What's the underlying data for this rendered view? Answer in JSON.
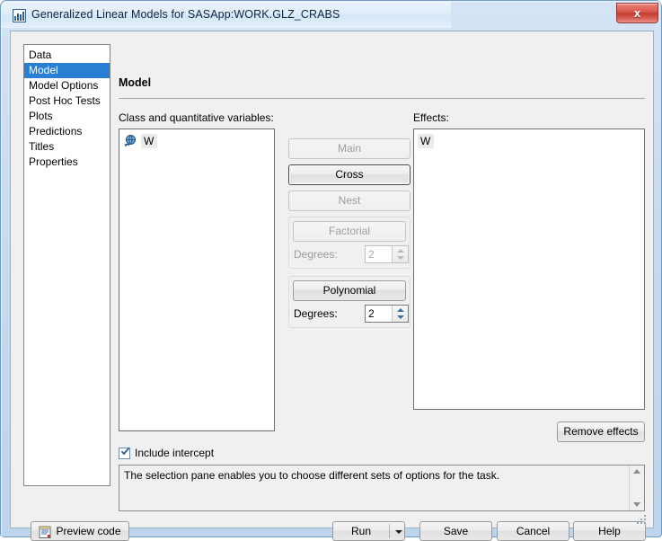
{
  "window": {
    "title": "Generalized Linear Models for SASApp:WORK.GLZ_CRABS",
    "title_icon": "chart-icon",
    "close_label": "x"
  },
  "sidebar": {
    "items": [
      {
        "label": "Data",
        "selected": false
      },
      {
        "label": "Model",
        "selected": true
      },
      {
        "label": "Model Options",
        "selected": false
      },
      {
        "label": "Post Hoc Tests",
        "selected": false
      },
      {
        "label": "Plots",
        "selected": false
      },
      {
        "label": "Predictions",
        "selected": false
      },
      {
        "label": "Titles",
        "selected": false
      },
      {
        "label": "Properties",
        "selected": false
      }
    ]
  },
  "page": {
    "heading": "Model"
  },
  "variables": {
    "label": "Class and quantitative variables:",
    "items": [
      {
        "name": "W",
        "icon": "variable-globe-icon",
        "selected": true
      }
    ]
  },
  "effects": {
    "label": "Effects:",
    "items": [
      {
        "name": "W",
        "selected": true
      }
    ],
    "remove_label": "Remove effects"
  },
  "builder": {
    "main_label": "Main",
    "main_enabled": false,
    "cross_label": "Cross",
    "cross_enabled": true,
    "nest_label": "Nest",
    "nest_enabled": false,
    "factorial_label": "Factorial",
    "factorial_enabled": false,
    "factorial_degrees_label": "Degrees:",
    "factorial_degrees_value": "2",
    "polynomial_label": "Polynomial",
    "polynomial_enabled": true,
    "polynomial_degrees_label": "Degrees:",
    "polynomial_degrees_value": "2"
  },
  "intercept": {
    "label": "Include intercept",
    "checked": true
  },
  "info": {
    "text": "The selection pane enables you to choose different sets of options for the task."
  },
  "footer": {
    "preview_label": "Preview code",
    "preview_icon": "notepad-icon",
    "run_label": "Run",
    "save_label": "Save",
    "cancel_label": "Cancel",
    "help_label": "Help"
  },
  "colors": {
    "selection_blue": "#2a7fd4",
    "titlebar_blue": "#d4e4f5",
    "close_red": "#c33c31",
    "dialog_gray": "#f0f0f0"
  }
}
